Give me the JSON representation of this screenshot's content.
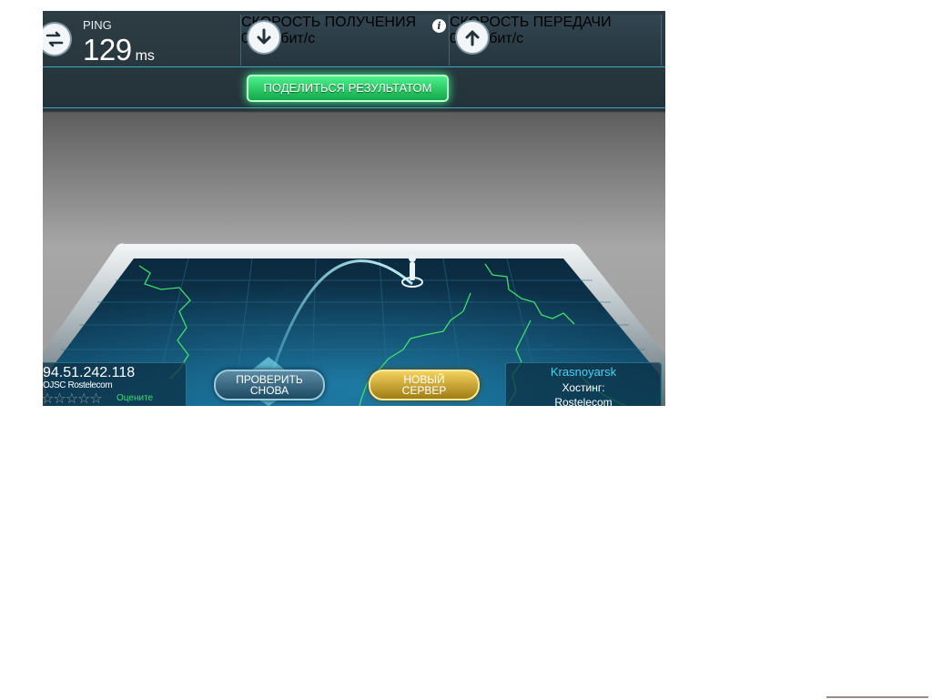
{
  "stats": {
    "ping": {
      "label": "PING",
      "value": "129",
      "unit": "ms",
      "icon": "swap-arrows-icon"
    },
    "download": {
      "label": "СКОРОСТЬ ПОЛУЧЕНИЯ",
      "value": "0.11",
      "unit": "Мбит/с",
      "icon": "download-arrow-icon"
    },
    "upload": {
      "label": "СКОРОСТЬ ПЕРЕДАЧИ",
      "value": "0.11",
      "unit": "Мбит/с",
      "icon": "upload-arrow-icon"
    }
  },
  "share_button": "ПОДЕЛИТЬСЯ РЕЗУЛЬТАТОМ",
  "info_icon": "i",
  "client": {
    "ip": "94.51.242.118",
    "isp": "OJSC Rostelecom",
    "stars": "☆☆☆☆☆",
    "rate_label": "Оцените"
  },
  "buttons": {
    "retest_line1": "ПРОВЕРИТЬ",
    "retest_line2": "СНОВА",
    "newserver_line1": "НОВЫЙ",
    "newserver_line2": "СЕРВЕР"
  },
  "server": {
    "city": "Krasnoyarsk",
    "hosting_label": "Хостинг:",
    "host": "Rostelecom"
  },
  "colors": {
    "accent_green": "#1fd866",
    "accent_cyan": "#46d4ef",
    "accent_gold": "#e7c040",
    "map_border": "#3fe06a"
  }
}
